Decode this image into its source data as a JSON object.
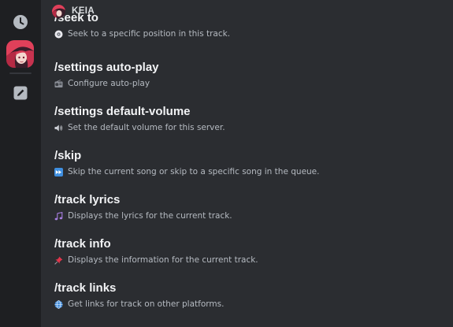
{
  "header": {
    "title": "KEIA",
    "avatar_icon": "bot-avatar"
  },
  "sidebar": {
    "items": [
      {
        "icon": "clock-icon",
        "label": "Recent"
      },
      {
        "icon": "app-avatar",
        "label": "KEIA"
      },
      {
        "icon": "pencil-icon",
        "label": "Edit"
      }
    ]
  },
  "commands": [
    {
      "name": "/seek to",
      "description": "Seek to a specific position in this track.",
      "icon": "cd-icon"
    },
    {
      "name": "/settings auto-play",
      "description": "Configure auto-play",
      "icon": "radio-icon"
    },
    {
      "name": "/settings default-volume",
      "description": "Set the default volume for this server.",
      "icon": "speaker-icon"
    },
    {
      "name": "/skip",
      "description": "Skip the current song or skip to a specific song in the queue.",
      "icon": "fast-forward-icon"
    },
    {
      "name": "/track lyrics",
      "description": "Displays the lyrics for the current track.",
      "icon": "music-notes-icon"
    },
    {
      "name": "/track info",
      "description": "Displays the information for the current track.",
      "icon": "pushpin-icon"
    },
    {
      "name": "/track links",
      "description": "Get links for track on other platforms.",
      "icon": "globe-icon"
    }
  ],
  "colors": {
    "sidebar_bg": "#1e1f22",
    "main_bg": "#2b2d31",
    "command_name": "#f2f3f5",
    "command_desc": "#b5bac1"
  }
}
